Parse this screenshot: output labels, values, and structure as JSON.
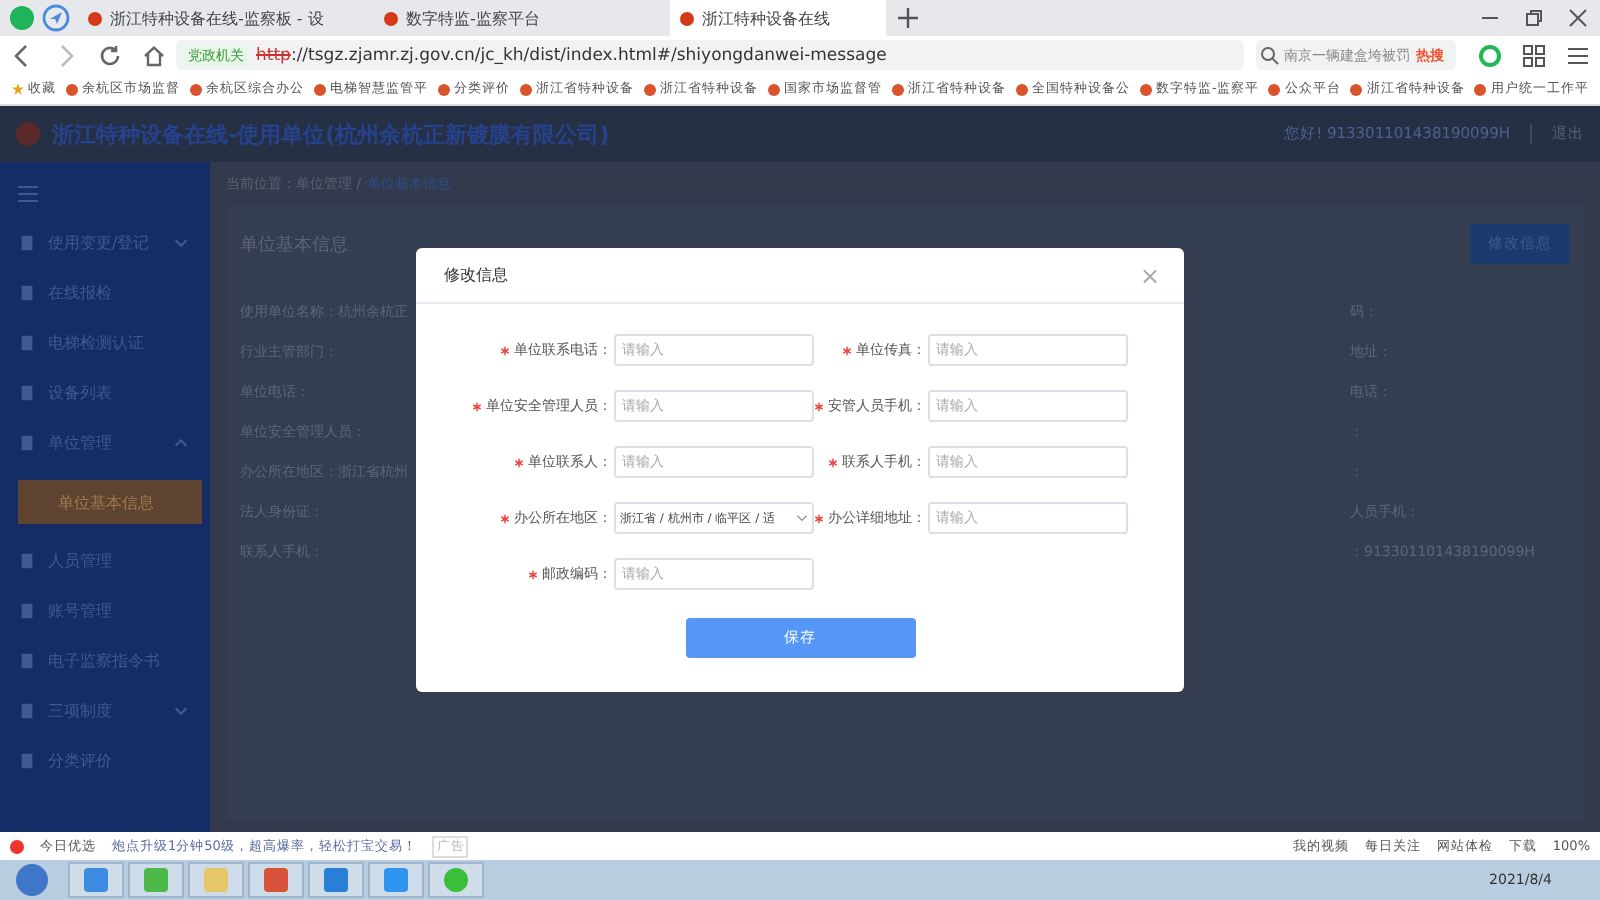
{
  "browser": {
    "tabs": [
      {
        "title": "浙江特种设备在线-监察板 - 设",
        "selected": false
      },
      {
        "title": "数字特监-监察平台",
        "selected": false
      },
      {
        "title": "浙江特种设备在线",
        "selected": true
      }
    ],
    "security_badge": "党政机关",
    "url_scheme": "http",
    "url": "://tsgz.zjamr.zj.gov.cn/jc_kh/dist/index.html#/shiyongdanwei-message",
    "search": {
      "placeholder": "南京一辆建盒垮被罚",
      "badge": "热搜"
    },
    "bookmarks": [
      "收藏",
      "余杭区市场监督",
      "余杭区综合办公",
      "电梯智慧监管平",
      "分类评价",
      "浙江省特种设备",
      "浙江省特种设备",
      "国家市场监督管",
      "浙江省特种设备",
      "全国特种设备公",
      "数字特监-监察平",
      "公众平台",
      "浙江省特种设备",
      "用户统一工作平"
    ]
  },
  "app": {
    "title": "浙江特种设备在线-使用单位(杭州余杭正新镀膜有限公司)",
    "user": "您好! 913301101438190099H",
    "logout": "退出"
  },
  "sidebar": {
    "items": [
      {
        "label": "使用变更/登记",
        "kind": "group",
        "expanded": false,
        "selected": false
      },
      {
        "label": "在线报检",
        "kind": "item",
        "selected": false
      },
      {
        "label": "电梯检测认证",
        "kind": "item",
        "selected": false
      },
      {
        "label": "设备列表",
        "kind": "item",
        "selected": false
      },
      {
        "label": "单位管理",
        "kind": "group",
        "expanded": true,
        "selected": false
      },
      {
        "label": "单位基本信息",
        "kind": "sub",
        "selected": true
      },
      {
        "label": "人员管理",
        "kind": "item",
        "selected": false
      },
      {
        "label": "账号管理",
        "kind": "item",
        "selected": false
      },
      {
        "label": "电子监察指令书",
        "kind": "item",
        "selected": false
      },
      {
        "label": "三项制度",
        "kind": "group",
        "expanded": false,
        "selected": false
      },
      {
        "label": "分类评价",
        "kind": "item",
        "selected": false
      }
    ]
  },
  "breadcrumb": {
    "prefix": "当前位置：单位管理 /",
    "current": "单位基本信息"
  },
  "card": {
    "title": "单位基本信息",
    "edit_button": "修改信息",
    "left_rows": [
      "使用单位名称：杭州余杭正",
      "行业主管部门：",
      "单位电话：",
      "单位安全管理人员：",
      "办公所在地区：浙江省杭州",
      "法人身份证：",
      "联系人手机："
    ],
    "right_rows": [
      "码：",
      "地址：",
      "电话：",
      "：",
      "：",
      "人员手机：",
      "：913301101438190099H"
    ]
  },
  "modal": {
    "title": "修改信息",
    "close": "×",
    "fields": [
      {
        "label": "单位联系电话：",
        "kind": "input",
        "placeholder": "请输入",
        "required": true
      },
      {
        "label": "单位传真：",
        "kind": "input",
        "placeholder": "请输入",
        "required": true
      },
      {
        "label": "单位安全管理人员：",
        "kind": "input",
        "placeholder": "请输入",
        "required": true
      },
      {
        "label": "安管人员手机：",
        "kind": "input",
        "placeholder": "请输入",
        "required": true
      },
      {
        "label": "单位联系人：",
        "kind": "input",
        "placeholder": "请输入",
        "required": true
      },
      {
        "label": "联系人手机：",
        "kind": "input",
        "placeholder": "请输入",
        "required": true
      },
      {
        "label": "办公所在地区：",
        "kind": "select",
        "value": "浙江省 / 杭州市 / 临平区 / 适",
        "required": true
      },
      {
        "label": "办公详细地址：",
        "kind": "input",
        "placeholder": "请输入",
        "required": true
      },
      {
        "label": "邮政编码：",
        "kind": "input",
        "placeholder": "请输入",
        "required": true
      }
    ],
    "save_button": "保存"
  },
  "status_bar": {
    "left": "今日优选",
    "ad": "炮点升级1分钟50级，超高爆率，轻松打宝交易！",
    "ad_tag": "广告",
    "right": [
      "我的视频",
      "每日关注",
      "网站体检"
    ],
    "download": "下载",
    "zoom": "100%"
  },
  "taskbar": {
    "date": "2021/8/4"
  }
}
